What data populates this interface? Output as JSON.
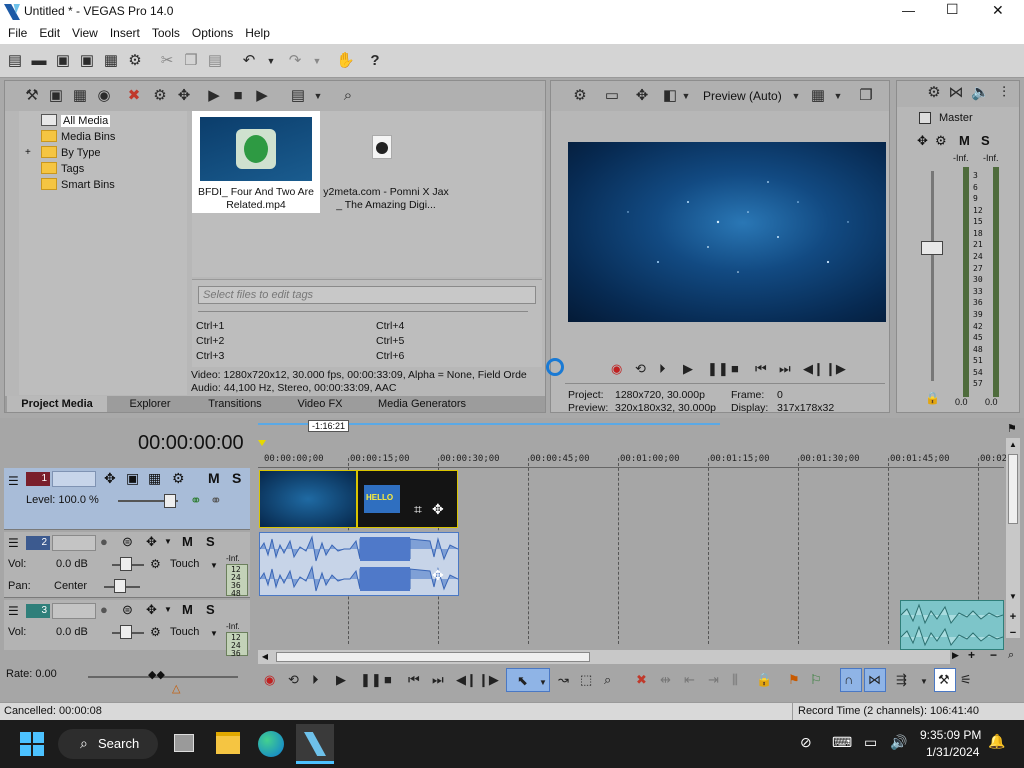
{
  "window": {
    "title": "Untitled * - VEGAS Pro 14.0",
    "min": "—",
    "max": "☐",
    "close": "✕"
  },
  "menu": [
    "File",
    "Edit",
    "View",
    "Insert",
    "Tools",
    "Options",
    "Help"
  ],
  "explorer": {
    "tree": [
      "All Media",
      "Media Bins",
      "By Type",
      "Tags",
      "Smart Bins"
    ],
    "expand_sign": "+",
    "media": [
      {
        "name": "BFDI_ Four And Two Are Related.mp4"
      },
      {
        "name": "y2meta.com - Pomni X Jax _ The Amazing Digi..."
      }
    ],
    "tags_placeholder": "Select files to edit tags",
    "shortcuts": [
      "Ctrl+1",
      "Ctrl+2",
      "Ctrl+3",
      "Ctrl+4",
      "Ctrl+5",
      "Ctrl+6"
    ],
    "info_video": "Video: 1280x720x12, 30.000 fps, 00:00:33:09, Alpha = None, Field Orde",
    "info_audio": "Audio: 44,100 Hz, Stereo, 00:00:33:09, AAC",
    "tabs": [
      "Project Media",
      "Explorer",
      "Transitions",
      "Video FX",
      "Media Generators"
    ]
  },
  "preview": {
    "mode": "Preview (Auto)",
    "project_label": "Project:",
    "project_value": "1280x720, 30.000p",
    "preview_label": "Preview:",
    "preview_value": "320x180x32, 30.000p",
    "frame_label": "Frame:",
    "frame_value": "0",
    "display_label": "Display:",
    "display_value": "317x178x32"
  },
  "master": {
    "label": "Master",
    "m": "M",
    "s": "S",
    "inf_left": "-Inf.",
    "inf_right": "-Inf.",
    "scale": [
      "3",
      "6",
      "9",
      "12",
      "15",
      "18",
      "21",
      "24",
      "27",
      "30",
      "33",
      "36",
      "39",
      "42",
      "45",
      "48",
      "51",
      "54",
      "57"
    ],
    "bottom_left": "0.0",
    "bottom_right": "0.0"
  },
  "timeline": {
    "timecode": "00:00:00:00",
    "loop_marker": "-1:16:21",
    "ruler": [
      "00:00:00;00",
      "00:00:15;00",
      "00:00:30;00",
      "00:00:45;00",
      "00:01:00;00",
      "00:01:15;00",
      "00:01:30;00",
      "00:01:45;00",
      "00:02"
    ],
    "clip_text": "HELLO",
    "tracks": [
      {
        "num": "1",
        "level": "Level: 100.0 %",
        "m": "M",
        "s": "S"
      },
      {
        "num": "2",
        "vol_label": "Vol:",
        "vol": "0.0 dB",
        "pan_label": "Pan:",
        "pan": "Center",
        "touch": "Touch",
        "m": "M",
        "s": "S",
        "inf": "-Inf.",
        "levels": [
          "12",
          "24",
          "36",
          "48"
        ]
      },
      {
        "num": "3",
        "vol_label": "Vol:",
        "vol": "0.0 dB",
        "touch": "Touch",
        "m": "M",
        "s": "S",
        "inf": "-Inf.",
        "levels": [
          "12",
          "24",
          "36"
        ]
      }
    ],
    "rate": "Rate: 0.00"
  },
  "status": {
    "left": "Cancelled: 00:00:08",
    "right": "Record Time (2 channels): 106:41:40"
  },
  "taskbar": {
    "search": "Search",
    "time": "9:35:09 PM",
    "date": "1/31/2024"
  },
  "colors": {
    "accent": "#0078d4",
    "track_header": "#a8b8d4",
    "record": "#cc2222"
  }
}
